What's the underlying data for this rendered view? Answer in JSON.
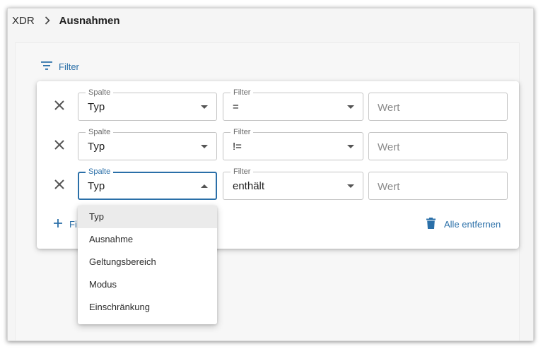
{
  "breadcrumb": {
    "root": "XDR",
    "current": "Ausnahmen"
  },
  "filter_toggle": {
    "label": "Filter",
    "icon": "filter-list-icon"
  },
  "filters": [
    {
      "column_legend": "Spalte",
      "column": "Typ",
      "operator_legend": "Filter",
      "operator": "=",
      "value_placeholder": "Wert",
      "value": ""
    },
    {
      "column_legend": "Spalte",
      "column": "Typ",
      "operator_legend": "Filter",
      "operator": "!=",
      "value_placeholder": "Wert",
      "value": ""
    },
    {
      "column_legend": "Spalte",
      "column": "Typ",
      "operator_legend": "Filter",
      "operator": "enthält",
      "value_placeholder": "Wert",
      "value": ""
    }
  ],
  "add_filter": {
    "label_visible": "Fi",
    "icon": "plus-icon"
  },
  "remove_all": {
    "label": "Alle entfernen",
    "icon": "trash-icon"
  },
  "column_menu": {
    "options": [
      "Typ",
      "Ausnahme",
      "Geltungsbereich",
      "Modus",
      "Einschränkung"
    ],
    "selected": "Typ"
  },
  "colors": {
    "accent": "#2a6fa8",
    "background": "#f5f5f5",
    "surface": "#ffffff",
    "menu_selected": "#ebebeb"
  }
}
